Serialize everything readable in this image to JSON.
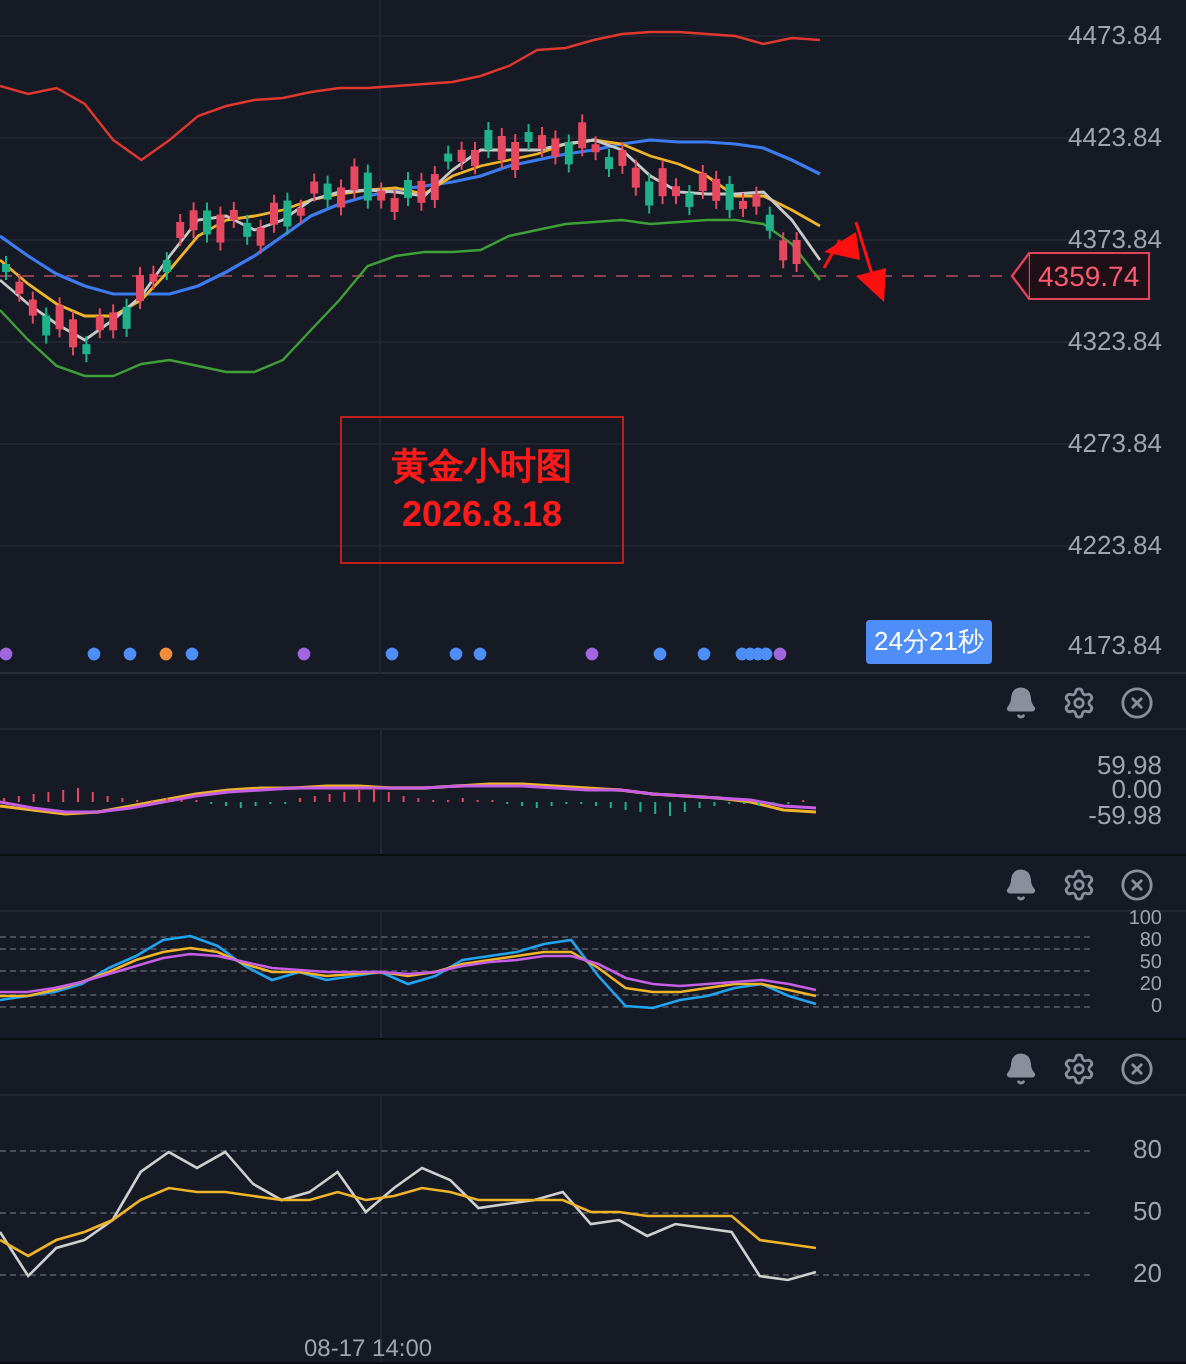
{
  "main_pane": {
    "price_axis": [
      "4473.84",
      "4423.84",
      "4373.84",
      "4323.84",
      "4273.84",
      "4223.84",
      "4173.84"
    ],
    "current_price": "4359.74",
    "annotation": {
      "title": "黄金小时图",
      "date": "2026.8.18"
    },
    "countdown": "24分21秒",
    "signal_dots": [
      {
        "color": "#a066e0"
      },
      {
        "color": "#4d8ef7"
      },
      {
        "color": "#4d8ef7"
      },
      {
        "color": "#f08c3a"
      },
      {
        "color": "#4d8ef7"
      },
      {
        "color": "#a066e0"
      },
      {
        "color": "#4d8ef7"
      },
      {
        "color": "#4d8ef7"
      },
      {
        "color": "#4d8ef7"
      },
      {
        "color": "#a066e0"
      },
      {
        "color": "#4d8ef7"
      },
      {
        "color": "#4d8ef7"
      },
      {
        "color": "#4d8ef7"
      },
      {
        "color": "#4d8ef7"
      },
      {
        "color": "#4d8ef7"
      },
      {
        "color": "#4d8ef7"
      },
      {
        "color": "#a066e0"
      }
    ]
  },
  "indicator_panes": [
    {
      "kind": "macd",
      "axis": [
        "59.98",
        "0.00",
        "-59.98"
      ]
    },
    {
      "kind": "kdj",
      "axis": [
        "100",
        "80",
        "50",
        "20",
        "0"
      ]
    },
    {
      "kind": "rsi",
      "axis": [
        "80",
        "50",
        "20"
      ]
    }
  ],
  "time_axis": [
    "08-17 14:00"
  ]
}
